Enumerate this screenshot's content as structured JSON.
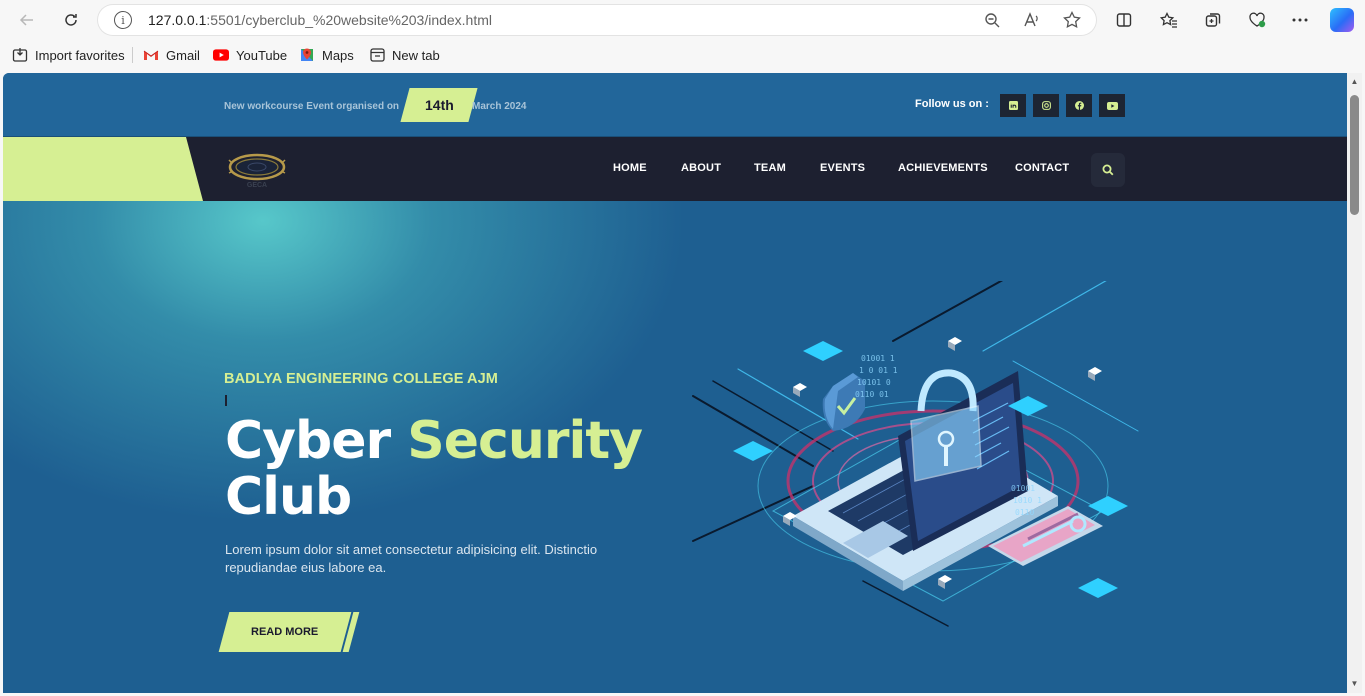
{
  "browser": {
    "url_host": "127.0.0.1",
    "url_path": ":5501/cyberclub_%20website%203/index.html",
    "bookmarks": [
      "Import favorites",
      "Gmail",
      "YouTube",
      "Maps",
      "New tab"
    ]
  },
  "topbar": {
    "event_prefix": "New workcourse Event organised on",
    "event_day": "14th",
    "event_month": "March 2024",
    "follow_label": "Follow us on :",
    "socials": [
      "linkedin-icon",
      "instagram-icon",
      "facebook-icon",
      "youtube-icon"
    ]
  },
  "nav": {
    "logo_text": "GECA",
    "links": [
      "HOME",
      "ABOUT",
      "TEAM",
      "EVENTS",
      "ACHIEVEMENTS",
      "CONTACT"
    ]
  },
  "hero": {
    "eyebrow": "BADLYA ENGINEERING COLLEGE AJM",
    "title_white": "Cyber ",
    "title_accent": "Security",
    "title_line2": "Club",
    "description": "Lorem ipsum dolor sit amet consectetur adipisicing elit. Distinctio repudiandae eius labore ea.",
    "cta_label": "READ MORE"
  },
  "colors": {
    "accent": "#d6ef93",
    "primary": "#1e5f91",
    "nav_dark": "#1d2030"
  }
}
